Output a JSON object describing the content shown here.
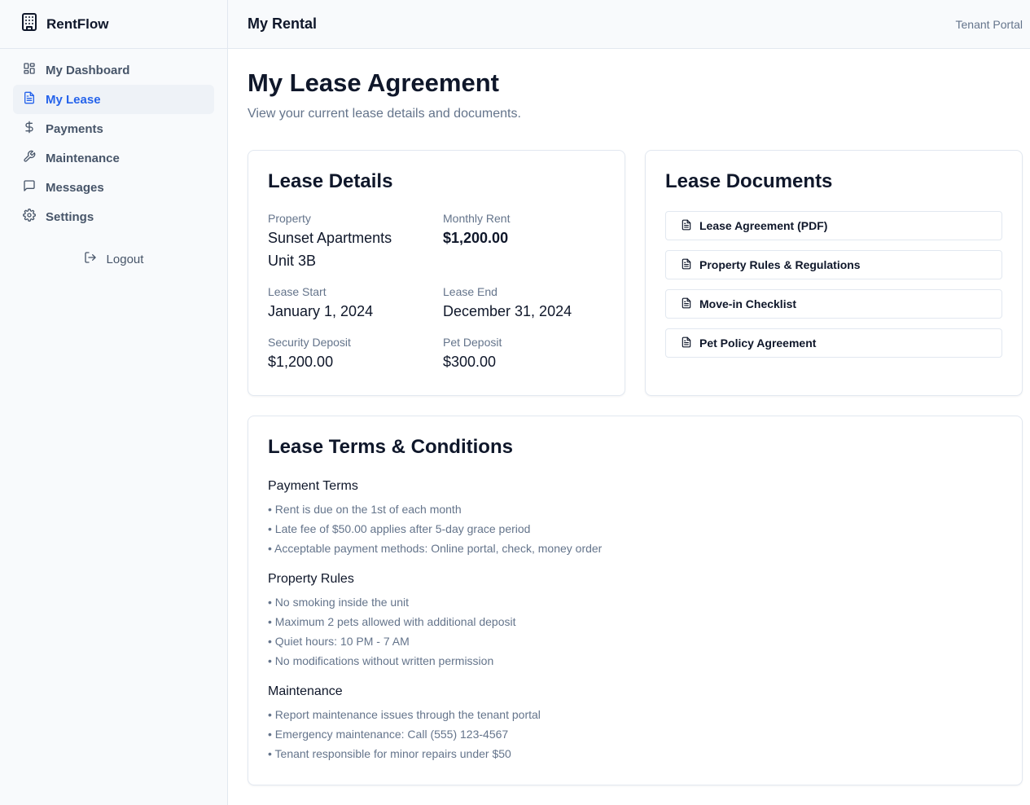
{
  "brand": {
    "name": "RentFlow"
  },
  "sidebar": {
    "items": [
      {
        "label": "My Dashboard",
        "icon": "grid-icon",
        "active": false
      },
      {
        "label": "My Lease",
        "icon": "document-icon",
        "active": true
      },
      {
        "label": "Payments",
        "icon": "dollar-icon",
        "active": false
      },
      {
        "label": "Maintenance",
        "icon": "wrench-icon",
        "active": false
      },
      {
        "label": "Messages",
        "icon": "message-icon",
        "active": false
      },
      {
        "label": "Settings",
        "icon": "gear-icon",
        "active": false
      }
    ],
    "logout_label": "Logout"
  },
  "header": {
    "title": "My Rental",
    "right_label": "Tenant Portal"
  },
  "page": {
    "title": "My Lease Agreement",
    "subtitle": "View your current lease details and documents."
  },
  "lease_details": {
    "title": "Lease Details",
    "property_label": "Property",
    "property_line1": "Sunset Apartments",
    "property_line2": "Unit 3B",
    "rent_label": "Monthly Rent",
    "rent_value": "$1,200.00",
    "start_label": "Lease Start",
    "start_value": "January 1, 2024",
    "end_label": "Lease End",
    "end_value": "December 31, 2024",
    "security_label": "Security Deposit",
    "security_value": "$1,200.00",
    "pet_label": "Pet Deposit",
    "pet_value": "$300.00"
  },
  "documents": {
    "title": "Lease Documents",
    "items": [
      "Lease Agreement (PDF)",
      "Property Rules & Regulations",
      "Move-in Checklist",
      "Pet Policy Agreement"
    ]
  },
  "terms": {
    "title": "Lease Terms & Conditions",
    "sections": [
      {
        "title": "Payment Terms",
        "items": [
          "• Rent is due on the 1st of each month",
          "• Late fee of $50.00 applies after 5-day grace period",
          "• Acceptable payment methods: Online portal, check, money order"
        ]
      },
      {
        "title": "Property Rules",
        "items": [
          "• No smoking inside the unit",
          "• Maximum 2 pets allowed with additional deposit",
          "• Quiet hours: 10 PM - 7 AM",
          "• No modifications without written permission"
        ]
      },
      {
        "title": "Maintenance",
        "items": [
          "• Report maintenance issues through the tenant portal",
          "• Emergency maintenance: Call (555) 123-4567",
          "• Tenant responsible for minor repairs under $50"
        ]
      }
    ]
  },
  "colors": {
    "accent": "#2563eb",
    "muted": "#64748b",
    "border": "#e2e8f0",
    "sidebar_bg": "#f8fafc"
  }
}
